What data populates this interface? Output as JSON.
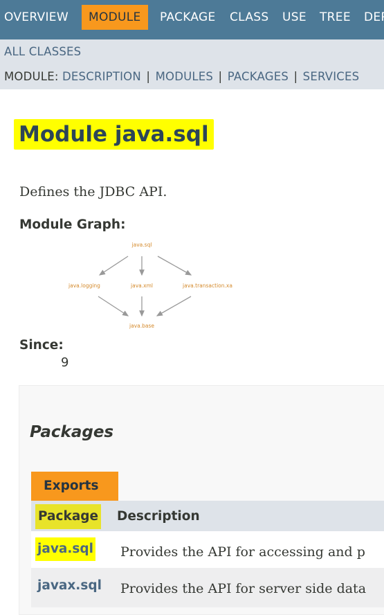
{
  "topnav": {
    "items": [
      "OVERVIEW",
      "MODULE",
      "PACKAGE",
      "CLASS",
      "USE",
      "TREE",
      "DEPRECATED"
    ],
    "active": "MODULE",
    "colors": {
      "bar": "#4d7a97",
      "active": "#f8981d"
    }
  },
  "subnav": {
    "all_classes": "ALL CLASSES",
    "module_label": "MODULE: ",
    "links": [
      "DESCRIPTION",
      "MODULES",
      "PACKAGES",
      "SERVICES"
    ],
    "separator": "|"
  },
  "page": {
    "title": "Module java.sql",
    "description": "Defines the JDBC API.",
    "graph_label": "Module Graph:",
    "since_label": "Since:",
    "since_value": "9"
  },
  "graph": {
    "nodes": {
      "top": "java.sql",
      "left": "java.logging",
      "middle": "java.xml",
      "right": "java.transaction.xa",
      "bottom": "java.base"
    }
  },
  "packages": {
    "heading": "Packages",
    "tab": "Exports",
    "columns": [
      "Package",
      "Description"
    ],
    "rows": [
      {
        "name": "java.sql",
        "description": "Provides the API for accessing and p"
      },
      {
        "name": "javax.sql",
        "description": "Provides the API for server side data"
      }
    ]
  },
  "highlight_color": "#ffff00"
}
